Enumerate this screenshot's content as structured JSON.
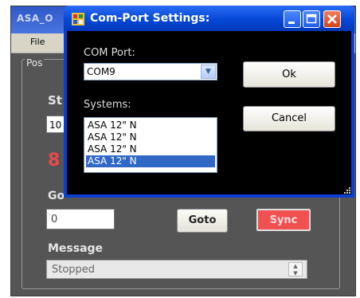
{
  "main_window": {
    "title": "ASA_O",
    "menu": {
      "file": "File"
    },
    "position_group_legend": "Pos",
    "st_label": "St",
    "st_value": "10",
    "red_digit": "8",
    "go_label": "Go",
    "goto_value": "0",
    "goto_button": "Goto",
    "sync_button": "Sync",
    "message_label": "Message",
    "message_value": "Stopped"
  },
  "dialog": {
    "title": "Com-Port Settings:",
    "com_port_label": "COM Port:",
    "com_port_value": "COM9",
    "systems_label": "Systems:",
    "systems": [
      "ASA 12\" N",
      "ASA 12\" N",
      "ASA 12\" N",
      "ASA 12\" N"
    ],
    "selected_system_index": 3,
    "ok_button": "Ok",
    "cancel_button": "Cancel"
  },
  "colors": {
    "dialog_titlebar": "#0548d6",
    "sync_button": "#f05050",
    "selection": "#3168c6"
  }
}
